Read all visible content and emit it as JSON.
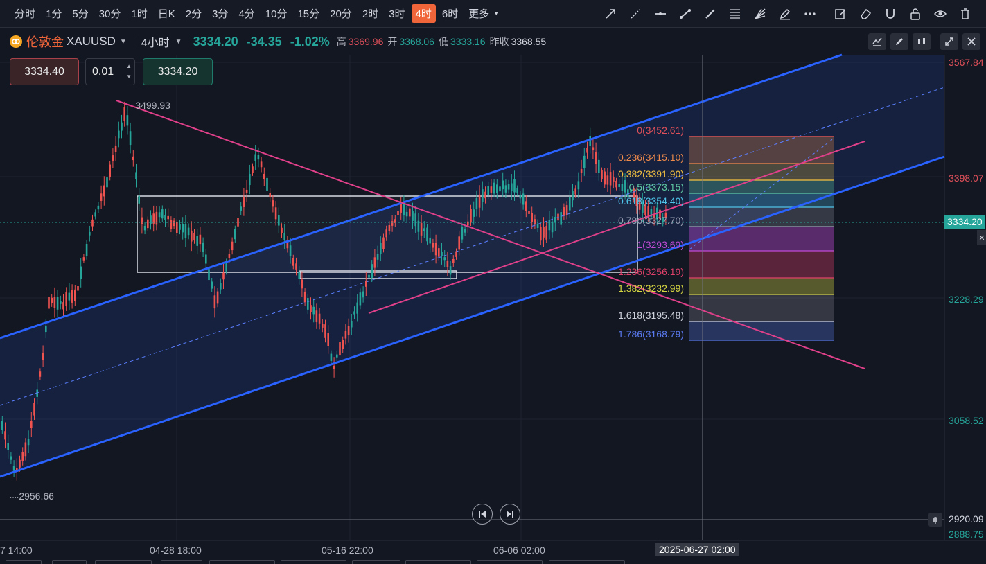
{
  "timeframes": [
    {
      "label": "分时",
      "active": false
    },
    {
      "label": "1分",
      "active": false
    },
    {
      "label": "5分",
      "active": false
    },
    {
      "label": "30分",
      "active": false
    },
    {
      "label": "1时",
      "active": false
    },
    {
      "label": "日K",
      "active": false
    },
    {
      "label": "2分",
      "active": false
    },
    {
      "label": "3分",
      "active": false
    },
    {
      "label": "4分",
      "active": false
    },
    {
      "label": "10分",
      "active": false
    },
    {
      "label": "15分",
      "active": false
    },
    {
      "label": "20分",
      "active": false
    },
    {
      "label": "2时",
      "active": false
    },
    {
      "label": "3时",
      "active": false
    },
    {
      "label": "4时",
      "active": true
    },
    {
      "label": "6时",
      "active": false
    },
    {
      "label": "更多",
      "active": false
    }
  ],
  "drawing_tools": [
    "arrow-line-icon",
    "dashed-ray-icon",
    "horizontal-line-icon",
    "trend-line-icon",
    "segment-icon",
    "fibonacci-icon",
    "fan-icon",
    "pen-icon",
    "more-dots-icon",
    "edit-icon",
    "eraser-icon",
    "magnet-icon",
    "lock-icon",
    "eye-icon",
    "trash-icon"
  ],
  "symbol": {
    "name": "伦敦金",
    "code": "XAUUSD",
    "interval": "4小时",
    "last": "3334.20",
    "change": "-34.35",
    "change_pct": "-1.02%",
    "high_label": "高",
    "high": "3369.96",
    "open_label": "开",
    "open": "3368.06",
    "low_label": "低",
    "low": "3333.16",
    "prev_label": "昨收",
    "prev": "3368.55"
  },
  "order": {
    "bid": "3334.40",
    "lot": "0.01",
    "ask": "3334.20"
  },
  "price_axis": [
    {
      "label": "3567.84",
      "color": "#e0505a"
    },
    {
      "label": "3398.07",
      "color": "#e0505a"
    },
    {
      "label": "3228.29",
      "color": "#26a69a"
    },
    {
      "label": "3058.52",
      "color": "#26a69a"
    },
    {
      "label": "2920.09",
      "color": "#d1d4dc"
    },
    {
      "label": "2888.75",
      "color": "#26a69a"
    }
  ],
  "current_price_tag": "3334.20",
  "time_axis": [
    "7 14:00",
    "04-28 18:00",
    "05-16 22:00",
    "06-06 02:00"
  ],
  "crosshair_time": "2025-06-27 02:00",
  "extremes": {
    "high": "3499.93",
    "low": "2956.66"
  },
  "fib_levels": [
    {
      "label": "0(3452.61)",
      "color": "#e0505a"
    },
    {
      "label": "0.236(3415.10)",
      "color": "#f08a4b"
    },
    {
      "label": "0.382(3391.90)",
      "color": "#f5c242"
    },
    {
      "label": "0.5(3373.15)",
      "color": "#5fc9a4"
    },
    {
      "label": "0.618(3354.40)",
      "color": "#4fc3e8"
    },
    {
      "label": "0.786(3327.70)",
      "color": "#9aa0b4"
    },
    {
      "label": "1(3293.69)",
      "color": "#c24bd6"
    },
    {
      "label": "1.236(3256.19)",
      "color": "#e0406a"
    },
    {
      "label": "1.382(3232.99)",
      "color": "#d6d642"
    },
    {
      "label": "1.618(3195.48)",
      "color": "#d1d4dc"
    },
    {
      "label": "1.786(3168.79)",
      "color": "#5a7af0"
    }
  ],
  "colors": {
    "up": "#26a69a",
    "down": "#ef5350",
    "channel": "#2962ff",
    "resistance": "#e0408a",
    "accent": "#f0663a"
  }
}
